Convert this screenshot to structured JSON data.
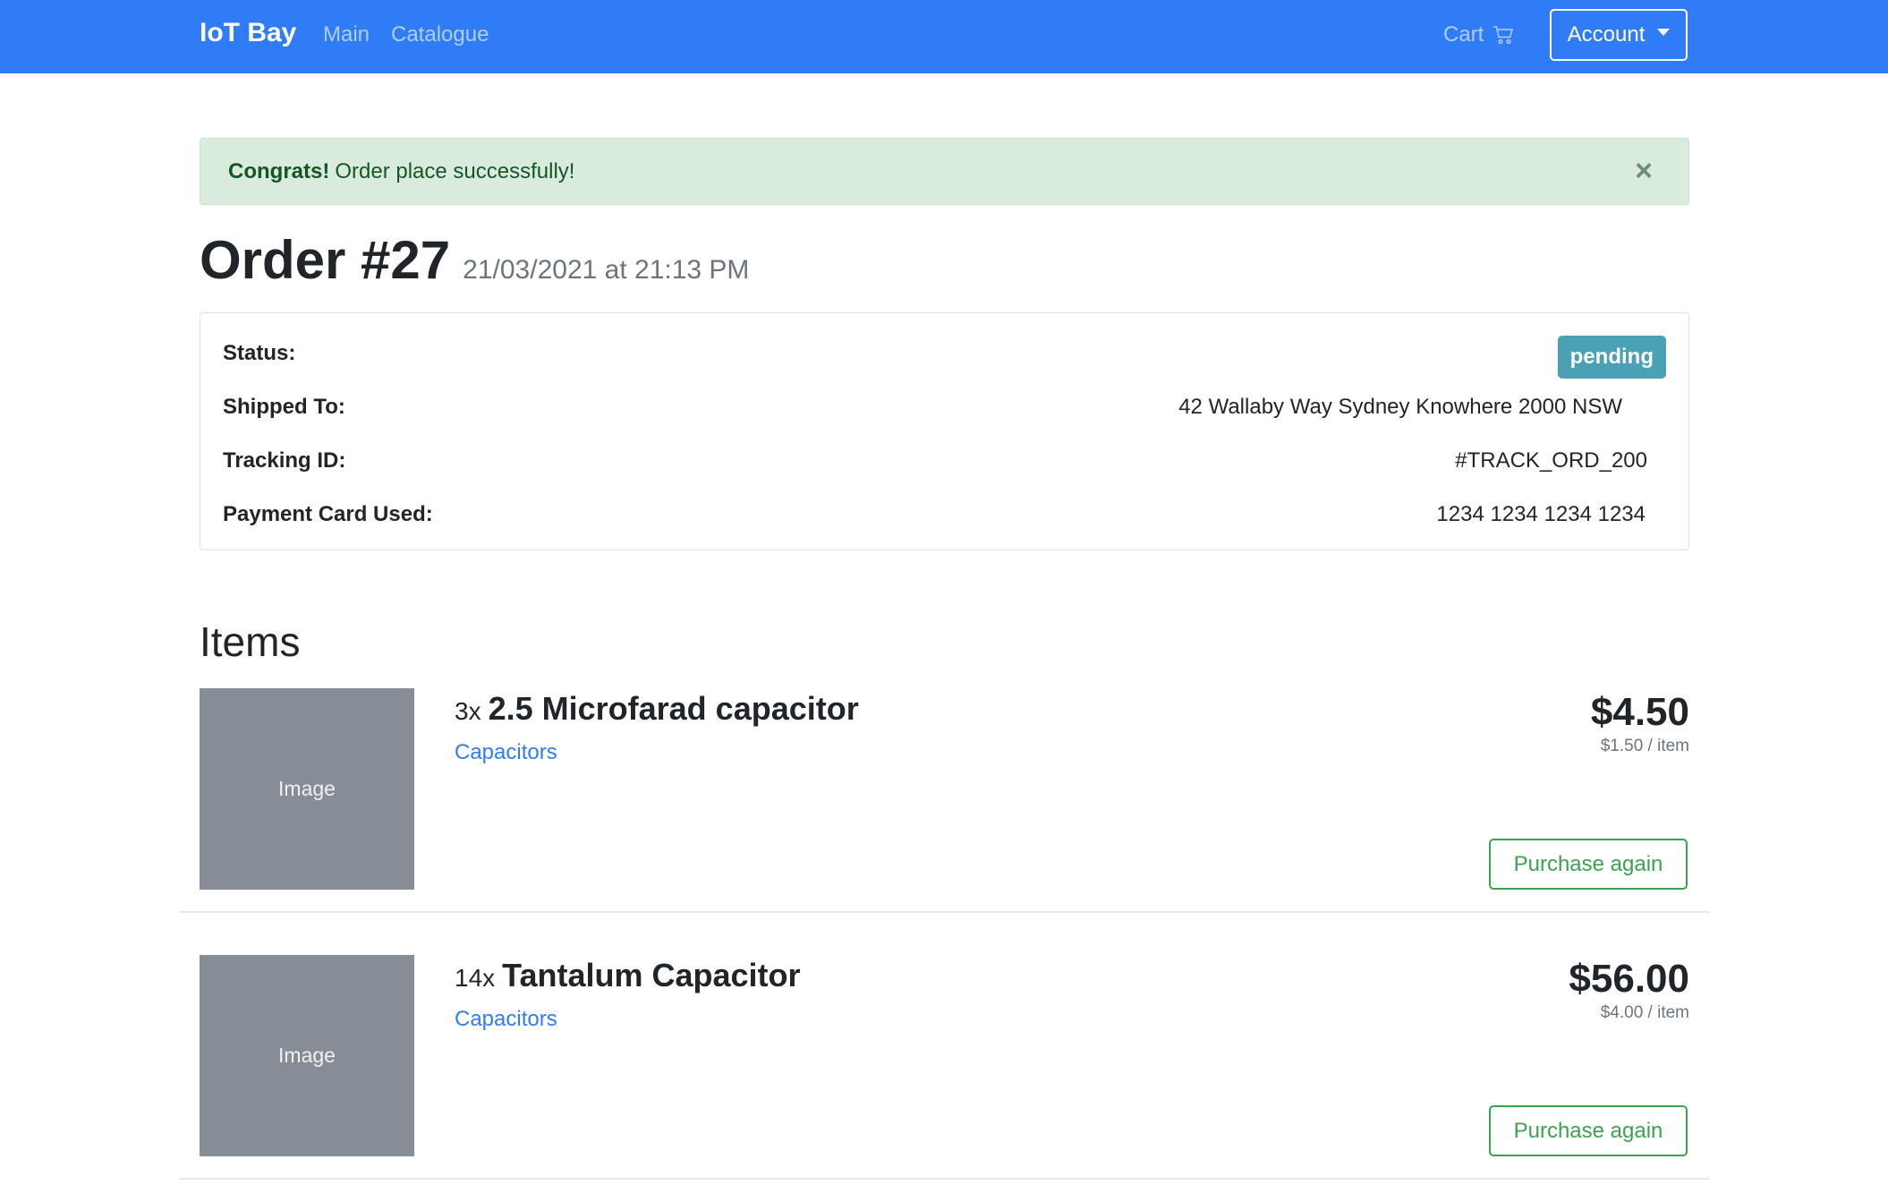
{
  "navbar": {
    "brand": "IoT Bay",
    "links": [
      {
        "label": "Main"
      },
      {
        "label": "Catalogue"
      }
    ],
    "cart_label": "Cart",
    "cart_icon": "cart-icon",
    "account_label": "Account"
  },
  "alert": {
    "strong": "Congrats!",
    "message": "Order place successfully!",
    "close_symbol": "×",
    "color": "#d9ebdd"
  },
  "order": {
    "title": "Order #27",
    "date": "21/03/2021 at 21:13 PM",
    "status_label": "Status:",
    "status_value": "pending",
    "shipped_label": "Shipped To:",
    "shipped_value": "42 Wallaby Way Sydney Knowhere 2000 NSW",
    "tracking_label": "Tracking ID:",
    "tracking_value": "#TRACK_ORD_200",
    "payment_label": "Payment Card Used:",
    "payment_value": "1234 1234 1234 1234"
  },
  "items_heading": "Items",
  "items": [
    {
      "image_label": "Image",
      "qty": "3x",
      "name": "2.5 Microfarad capacitor",
      "category": "Capacitors",
      "total": "$4.50",
      "unit": "$1.50 / item",
      "button": "Purchase again"
    },
    {
      "image_label": "Image",
      "qty": "14x",
      "name": "Tantalum Capacitor",
      "category": "Capacitors",
      "total": "$56.00",
      "unit": "$4.00 / item",
      "button": "Purchase again"
    }
  ],
  "colors": {
    "navbar": "#307cf6",
    "badge": "#4aa0b5",
    "success": "#3ba34f",
    "link": "#307cf6"
  }
}
